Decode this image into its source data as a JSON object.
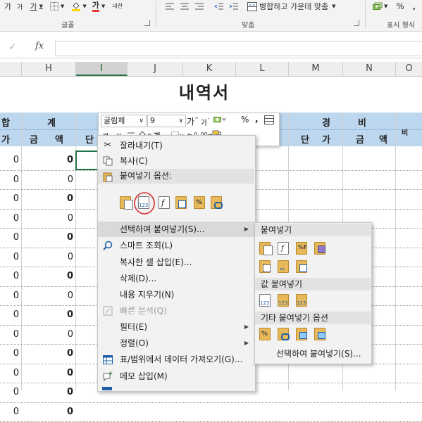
{
  "ribbon": {
    "top_row": {
      "font_size_up": "가",
      "font_size_down": "가",
      "underline": "가",
      "font_color": "가",
      "phonetic": "내천",
      "merge_center": "병합하고 가운데 맞춤",
      "percent": "%",
      "comma": ","
    },
    "groups": {
      "font": "글꼴",
      "alignment": "맞춤",
      "number": "표시 형식"
    }
  },
  "formula_bar": {
    "fx": "fx",
    "value": ""
  },
  "columns": [
    "H",
    "I",
    "J",
    "K",
    "L",
    "M",
    "N",
    "O"
  ],
  "sheet": {
    "title": "내역서",
    "header_row1": {
      "hap": "합",
      "gye": "계",
      "gyeong": "경",
      "bi": "비",
      "bi2": "비"
    },
    "header_row2": {
      "ga": "가",
      "geum": "금",
      "aek": "액",
      "dan": "단",
      "m_dan": "단",
      "m_ga": "가",
      "n_geum": "금",
      "n_aek": "액"
    },
    "g_values": [
      "0",
      "0",
      "0",
      "0",
      "0",
      "0",
      "0",
      "0",
      "0",
      "0",
      "0",
      "0",
      "0",
      "0"
    ],
    "h_values": [
      "0",
      "0",
      "0",
      "0",
      "0",
      "0",
      "0",
      "0",
      "0",
      "0",
      "0",
      "0",
      "0",
      "0"
    ]
  },
  "mini_toolbar": {
    "font_name": "굴림체",
    "font_size": "9",
    "percent": "%",
    "comma": ","
  },
  "context_menu": {
    "cut": "잘라내기(T)",
    "copy": "복사(C)",
    "paste_options": "붙여넣기 옵션:",
    "paste_special": "선택하여 붙여넣기(S)...",
    "smart_lookup": "스마트 조회(L)",
    "insert_copied": "복사한 셀 삽입(E)...",
    "delete": "삭제(D)...",
    "clear": "내용 지우기(N)",
    "quick_analysis": "빠른 분석(Q)",
    "filter": "필터(E)",
    "sort": "정렬(O)",
    "get_data": "표/범위에서 데이터 가져오기(G)...",
    "insert_comment": "메모 삽입(M)"
  },
  "submenu": {
    "paste": "붙여넣기",
    "paste_values": "값 붙여넣기",
    "other_paste": "기타 붙여넣기 옵션",
    "paste_special": "선택하여 붙여넣기(S)..."
  },
  "colors": {
    "header_fill": "#bdd7ee",
    "accent": "#217346",
    "highlight": "#d9d9d9",
    "circle": "#d32f2f"
  }
}
